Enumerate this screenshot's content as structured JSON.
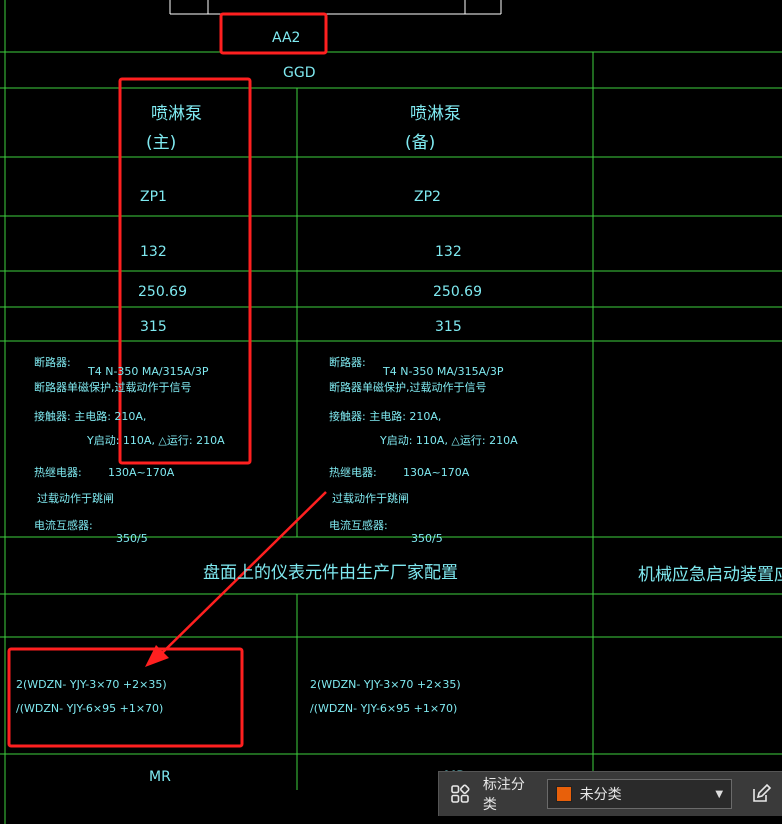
{
  "drawing": {
    "switchboard_id": "AA2",
    "cabinet_type": "GGD",
    "col1": {
      "name_line1": "喷淋泵",
      "name_line2": "(主)",
      "circuit": "ZP1",
      "v1": "132",
      "v2": "250.69",
      "v3": "315",
      "breaker_label": "断路器:",
      "breaker_model": "T4 N-350  MA/315A/3P",
      "breaker_note": "断路器单磁保护,过载动作于信号",
      "contactor_label": "接触器: 主电路: 210A,",
      "contactor_detail": "Y启动: 110A, △运行: 210A",
      "relay_label": "热继电器:",
      "relay_range": "130A~170A",
      "relay_note": "过载动作于跳闸",
      "ct_label": "电流互感器:",
      "ct_ratio": "350/5",
      "cable_line1": "2(WDZN- YJY-3×70 +2×35)",
      "cable_line2": "/(WDZN- YJY-6×95 +1×70)",
      "dest": "MR"
    },
    "col2": {
      "name_line1": "喷淋泵",
      "name_line2": "(备)",
      "circuit": "ZP2",
      "v1": "132",
      "v2": "250.69",
      "v3": "315",
      "breaker_label": "断路器:",
      "breaker_model": "T4 N-350  MA/315A/3P",
      "breaker_note": "断路器单磁保护,过载动作于信号",
      "contactor_label": "接触器: 主电路: 210A,",
      "contactor_detail": "Y启动: 110A, △运行: 210A",
      "relay_label": "热继电器:",
      "relay_range": "130A~170A",
      "relay_note": "过载动作于跳闸",
      "ct_label": "电流互感器:",
      "ct_ratio": "350/5",
      "cable_line1": "2(WDZN- YJY-3×70 +2×35)",
      "cable_line2": "/(WDZN- YJY-6×95 +1×70)",
      "dest": "MR"
    },
    "note_main": "盘面上的仪表元件由生产厂家配置",
    "note_right": "机械应急启动装置应设"
  },
  "toolbar": {
    "label": "标注分类",
    "select_value": "未分类",
    "swatch_color": "#e8600a",
    "layout_icon": "grid-layout-icon",
    "edit_icon": "edit-icon"
  },
  "colors": {
    "grid_line": "#3ecf3e",
    "text": "#7fe9f0",
    "annotation": "#ff2020"
  }
}
